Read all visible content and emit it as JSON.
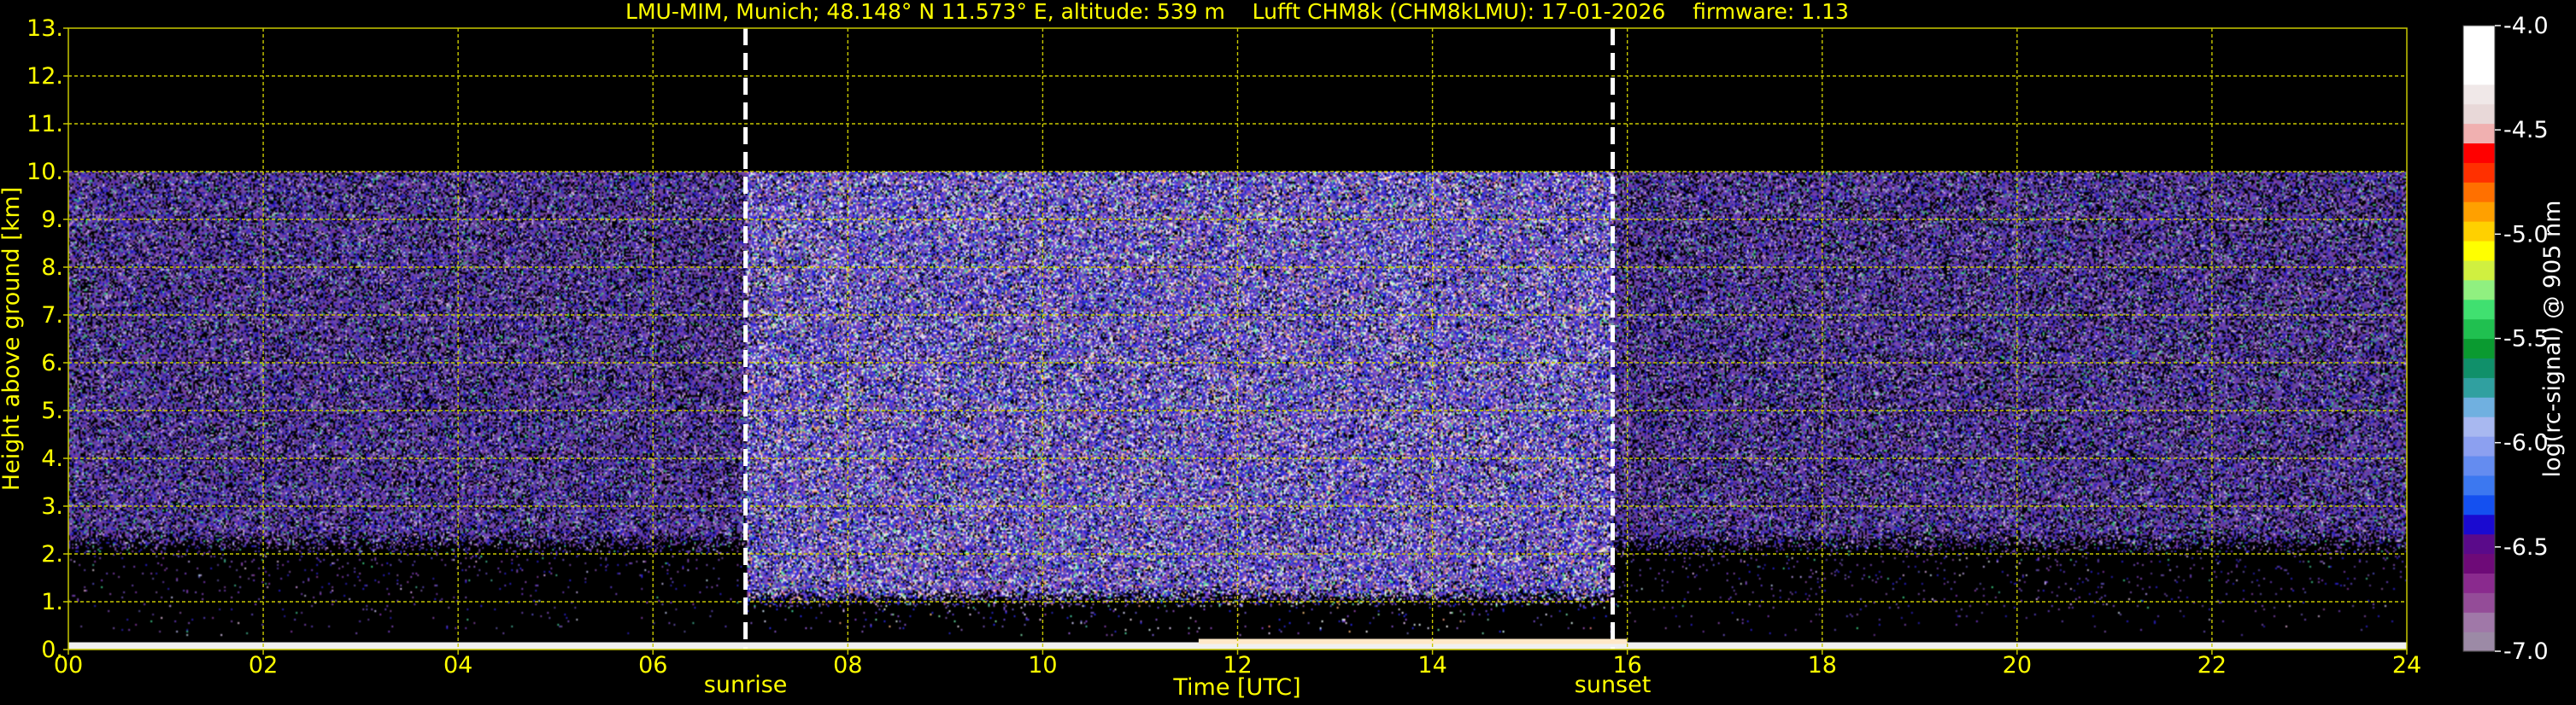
{
  "chart_data": {
    "type": "heatmap",
    "title": "LMU-MIM, Munich; 48.148° N 11.573° E, altitude: 539 m    Lufft CHM8k (CHM8kLMU): 17-01-2026    firmware: 1.13",
    "xlabel": "Time [UTC]",
    "ylabel": "Height above ground [km]",
    "xlim": [
      0,
      24
    ],
    "ylim": [
      0,
      13
    ],
    "x_ticks": [
      0,
      2,
      4,
      6,
      8,
      10,
      12,
      14,
      16,
      18,
      20,
      22,
      24
    ],
    "x_tick_labels": [
      "00",
      "02",
      "04",
      "06",
      "08",
      "10",
      "12",
      "14",
      "16",
      "18",
      "20",
      "22",
      "24"
    ],
    "y_ticks": [
      0,
      1,
      2,
      3,
      4,
      5,
      6,
      7,
      8,
      9,
      10,
      11,
      12,
      13
    ],
    "y_tick_labels": [
      "0.",
      "1.",
      "2.",
      "3.",
      "4.",
      "5.",
      "6.",
      "7.",
      "8.",
      "9.",
      "10.",
      "11.",
      "12.",
      "13."
    ],
    "grid": true,
    "data_top_km": 10,
    "markers": [
      {
        "label": "sunrise",
        "x": 6.95
      },
      {
        "label": "sunset",
        "x": 15.85
      }
    ],
    "colorbar": {
      "label": "log(rc-signal) @ 905 nm",
      "range": [
        -7.0,
        -4.0
      ],
      "tick_values": [
        -4.0,
        -4.5,
        -5.0,
        -5.5,
        -6.0,
        -6.5,
        -7.0
      ],
      "tick_labels": [
        "-4.0",
        "-4.5",
        "-5.0",
        "-5.5",
        "-6.0",
        "-6.5",
        "-7.0"
      ],
      "colors": [
        "#9c8aa6",
        "#a078a8",
        "#944c98",
        "#8a2a8e",
        "#6e0a78",
        "#5a0a8a",
        "#1a0ad0",
        "#1450f0",
        "#3c78f0",
        "#648cf0",
        "#8ca0f0",
        "#a8b8f0",
        "#70b0e0",
        "#30a0a0",
        "#10906a",
        "#0a9a30",
        "#20c050",
        "#40e070",
        "#90f080",
        "#d0f040",
        "#ffff00",
        "#ffd000",
        "#ffa000",
        "#ff7000",
        "#ff3000",
        "#ff0000",
        "#f0b0b0",
        "#e8d8d8",
        "#f0e8e8",
        "#ffffff",
        "#ffffff",
        "#ffffff"
      ]
    },
    "colors": {
      "text": "#ffff00",
      "grid": "#c8c800",
      "background": "#000000",
      "noise_base": "#5a3c9c",
      "marker": "#ffffff"
    }
  }
}
